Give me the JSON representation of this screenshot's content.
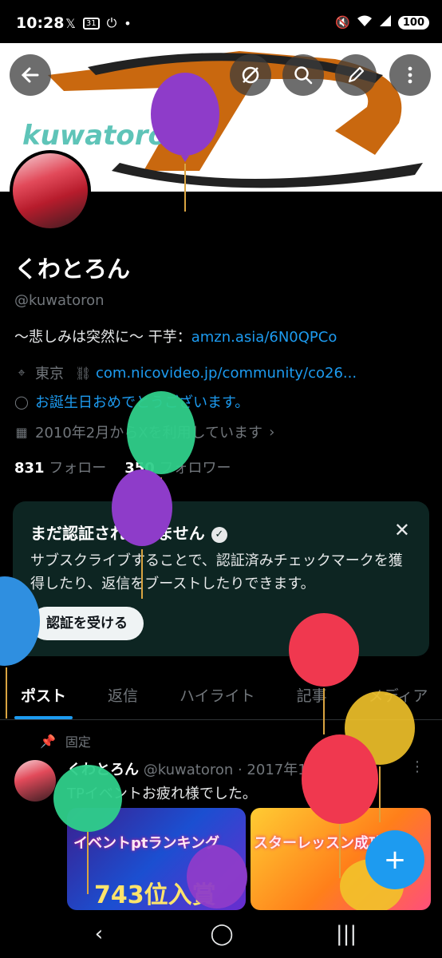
{
  "status_bar": {
    "time": "10:28",
    "left_icons": [
      "x-logo-icon",
      "calendar-31-icon",
      "power-icon",
      "dot-icon"
    ],
    "calendar_label": "31",
    "right_icons": [
      "mute-icon",
      "wifi-icon",
      "signal-icon"
    ],
    "battery": "100"
  },
  "banner": {
    "text": "kuwatoronn"
  },
  "top_actions": [
    "back-icon",
    "grok-icon",
    "search-icon",
    "edit-icon",
    "more-icon"
  ],
  "profile": {
    "name": "くわとろん",
    "handle": "@kuwatoron",
    "bio_text": "〜悲しみは突然に〜 干芋：",
    "bio_link": "amzn.asia/6N0QPCo",
    "location": "東京",
    "website": "com.nicovideo.jp/community/co26...",
    "birthday": "お誕生日おめでとうございます。",
    "joined": "2010年2月からXを利用しています",
    "following_count": "831",
    "following_label": "フォロー",
    "followers_count": "350",
    "followers_label": "フォロワー"
  },
  "verify_card": {
    "title": "まだ認証されていません",
    "description": "サブスクライブすることで、認証済みチェックマークを獲得したり、返信をブーストしたりできます。",
    "button": "認証を受ける",
    "close": "✕"
  },
  "tabs": [
    "ポスト",
    "返信",
    "ハイライト",
    "記事",
    "メディア"
  ],
  "pinned_label": "固定",
  "post": {
    "name": "くわとろん",
    "meta": "@kuwatoron · 2017年11月27日",
    "text": "TPイベントお疲れ様でした。",
    "media_left_caption": "イベントptランキング",
    "media_left_rank": "743位入賞",
    "media_right_caption": "スターレッスン成功!",
    "more": "⋮"
  },
  "fab_label": "+",
  "nav": [
    "back-nav-icon",
    "home-nav-icon",
    "recents-nav-icon"
  ],
  "colors": {
    "accent": "#1d9bf0",
    "verify_bg": "#0d2522",
    "banner_text": "#5ec4b8",
    "balloon_purple": "#8e3cc9",
    "balloon_green": "#2fcf8a",
    "balloon_red": "#f0384f",
    "balloon_yellow": "#f2c32a",
    "balloon_blue": "#2f8fe0"
  }
}
